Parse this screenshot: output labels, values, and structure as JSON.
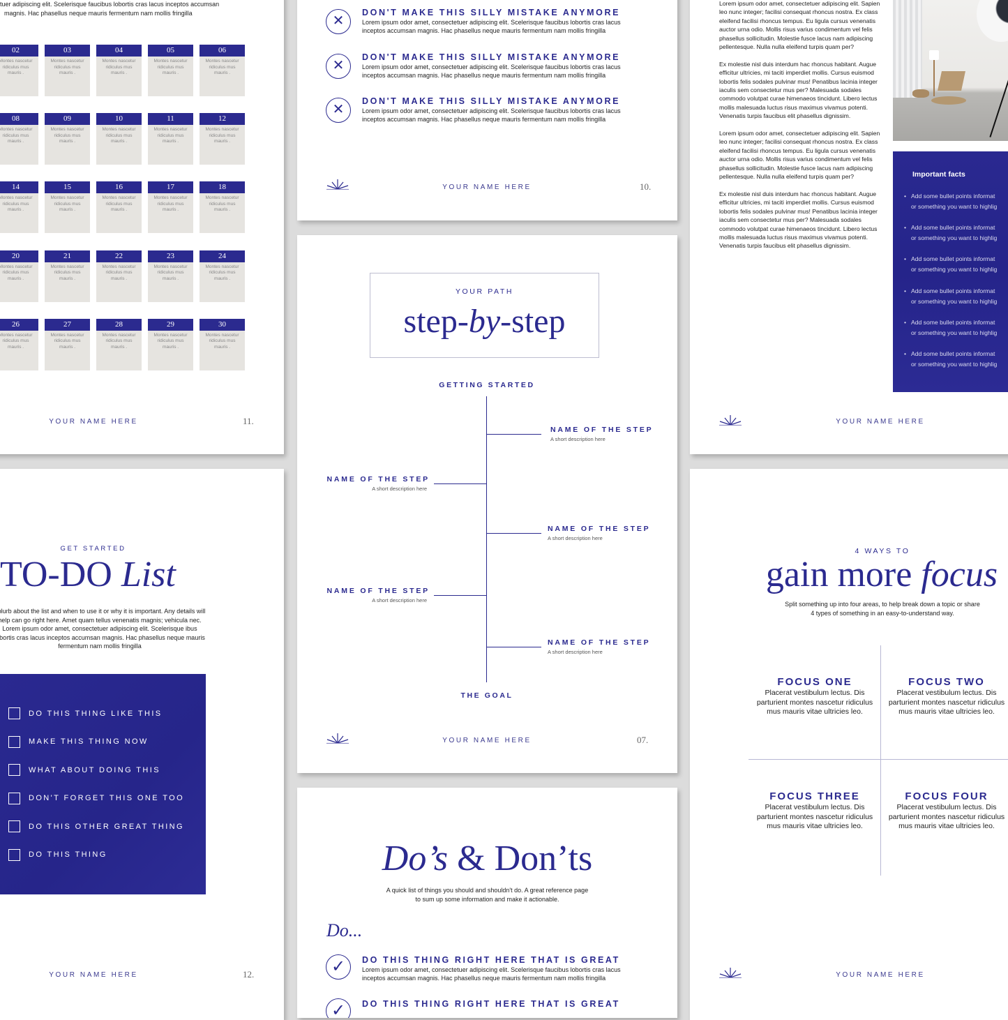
{
  "footer_name": "YOUR NAME HERE",
  "colors": {
    "accent": "#2b2a8f",
    "tile_bg": "#e6e4e0",
    "canvas": "#dcdcdc"
  },
  "calendar_page": {
    "intro_line1": "tuer adipiscing elit. Scelerisque faucibus lobortis cras lacus inceptos accumsan",
    "intro_line2": "magnis. Hac phasellus neque mauris fermentum nam mollis fringilla",
    "tile_text": "Montes nascetur ridiculus mus mauris .",
    "rows": [
      [
        "02",
        "03",
        "04",
        "05",
        "06"
      ],
      [
        "08",
        "09",
        "10",
        "11",
        "12"
      ],
      [
        "14",
        "15",
        "16",
        "17",
        "18"
      ],
      [
        "20",
        "21",
        "22",
        "23",
        "24"
      ],
      [
        "26",
        "27",
        "28",
        "29",
        "30"
      ]
    ],
    "page_number": "11."
  },
  "todo_page": {
    "eyebrow": "GET STARTED",
    "title_plain": "TO-DO ",
    "title_italic": "List",
    "blurb": "t blurb about the list and when to use it or why it is important. Any details will help can go right here.  Amet quam tellus venenatis magnis; vehicula nec. Lorem ipsum odor amet, consectetuer adipiscing elit. Scelerisque ibus lobortis cras lacus inceptos accumsan magnis. Hac phasellus neque mauris fermentum nam mollis fringilla",
    "items": [
      "DO THIS THING LIKE THIS",
      "MAKE THIS THING NOW",
      "WHAT ABOUT DOING THIS",
      "DON'T FORGET THIS ONE TOO",
      "DO THIS OTHER GREAT THING",
      "DO THIS THING"
    ],
    "page_number": "12."
  },
  "donts_page": {
    "items": [
      {
        "title": "DON'T MAKE THIS SILLY MISTAKE ANYMORE",
        "text": "Lorem ipsum odor amet, consectetuer adipiscing elit. Scelerisque faucibus lobortis cras lacus inceptos accumsan magnis. Hac phasellus neque mauris fermentum nam mollis fringilla",
        "icon": "x-mark-icon"
      },
      {
        "title": "DON'T MAKE THIS SILLY MISTAKE ANYMORE",
        "text": "Lorem ipsum odor amet, consectetuer adipiscing elit. Scelerisque faucibus lobortis cras lacus inceptos accumsan magnis. Hac phasellus neque mauris fermentum nam mollis fringilla",
        "icon": "x-mark-icon"
      },
      {
        "title": "DON'T MAKE THIS SILLY MISTAKE ANYMORE",
        "text": "Lorem ipsum odor amet, consectetuer adipiscing elit. Scelerisque faucibus lobortis cras lacus inceptos accumsan magnis. Hac phasellus neque mauris fermentum nam mollis fringilla",
        "icon": "x-mark-icon"
      }
    ],
    "page_number": "10."
  },
  "steps_page": {
    "eyebrow": "YOUR PATH",
    "title_a": "step-",
    "title_b": "by",
    "title_c": "-step",
    "start": "GETTING STARTED",
    "goal": "THE GOAL",
    "steps": [
      {
        "title": "NAME OF THE STEP",
        "desc": "A short description here",
        "side": "right"
      },
      {
        "title": "NAME OF THE STEP",
        "desc": "A short description here",
        "side": "left"
      },
      {
        "title": "NAME OF THE STEP",
        "desc": "A short description here",
        "side": "right"
      },
      {
        "title": "NAME OF THE STEP",
        "desc": "A short description here",
        "side": "left"
      },
      {
        "title": "NAME OF THE STEP",
        "desc": "A short description here",
        "side": "right"
      }
    ],
    "page_number": "07."
  },
  "dos_page": {
    "title_italic": "Do’s",
    "title_rest": " & Don’ts",
    "subtitle_line1": "A quick list of things you should and shouldn't do. A great reference page",
    "subtitle_line2": "to sum up some information and make it actionable.",
    "do_heading": "Do...",
    "items": [
      {
        "title": "DO THIS THING RIGHT HERE THAT IS GREAT",
        "text": "Lorem ipsum odor amet, consectetuer adipiscing elit. Scelerisque faucibus lobortis cras lacus inceptos accumsan magnis. Hac phasellus neque mauris fermentum nam mollis fringilla",
        "icon": "checkmark-icon"
      },
      {
        "title": "DO THIS THING RIGHT HERE THAT IS GREAT",
        "icon": "checkmark-icon"
      }
    ]
  },
  "article_page": {
    "paragraphs": [
      "Lorem ipsum odor amet, consectetuer adipiscing elit. Sapien leo nunc integer; facilisi consequat rhoncus nostra. Ex class eleifend facilisi rhoncus tempus. Eu ligula cursus venenatis auctor urna odio. Mollis risus varius condimentum vel felis phasellus sollicitudin. Molestie fusce lacus nam adipiscing pellentesque. Nulla nulla eleifend turpis quam per?",
      "Ex molestie nisl duis interdum hac rhoncus habitant. Augue efficitur ultricies, mi taciti imperdiet mollis. Cursus euismod lobortis felis sodales pulvinar mus! Penatibus lacinia integer iaculis sem consectetur mus per? Malesuada sodales commodo volutpat curae himenaeos tincidunt. Libero lectus mollis malesuada luctus risus maximus vivamus potenti. Venenatis turpis faucibus elit phasellus dignissim.",
      "Lorem ipsum odor amet, consectetuer adipiscing elit. Sapien leo nunc integer; facilisi consequat rhoncus nostra. Ex class eleifend facilisi rhoncus tempus. Eu ligula cursus venenatis auctor urna odio. Mollis risus varius condimentum vel felis phasellus sollicitudin. Molestie fusce lacus nam adipiscing pellentesque. Nulla nulla eleifend turpis quam per?",
      "Ex molestie nisl duis interdum hac rhoncus habitant. Augue efficitur ultricies, mi taciti imperdiet mollis. Cursus euismod lobortis felis sodales pulvinar mus! Penatibus lacinia integer iaculis sem consectetur mus per? Malesuada sodales commodo volutpat curae himenaeos tincidunt. Libero lectus mollis malesuada luctus risus maximus vivamus potenti. Venenatis turpis faucibus elit phasellus dignissim."
    ],
    "facts_title": "Important facts",
    "facts": [
      [
        "Add some bullet points informat",
        "or something you want to highlig"
      ],
      [
        "Add some bullet points informat",
        "or something you want to highlig"
      ],
      [
        "Add some bullet points informat",
        "or something you want to highlig"
      ],
      [
        "Add some bullet points informat",
        "or something you want to highlig"
      ],
      [
        "Add some bullet points informat",
        "or something you want to highlig"
      ],
      [
        "Add some bullet points informat",
        "or something you want to highlig"
      ]
    ]
  },
  "focus_page": {
    "eyebrow": "4 WAYS TO",
    "title_plain": "gain more ",
    "title_italic": "focus",
    "subtitle_line1": "Split something up into four areas, to help break down a topic or share",
    "subtitle_line2": "4 types of something in an easy-to-understand way.",
    "quadrants": [
      {
        "title": "FOCUS ONE",
        "text": "Placerat vestibulum lectus. Dis parturient montes nascetur ridiculus mus mauris vitae ultricies leo."
      },
      {
        "title": "FOCUS TWO",
        "text": "Placerat vestibulum lectus. Dis parturient montes nascetur ridiculus mus mauris vitae ultricies leo."
      },
      {
        "title": "FOCUS THREE",
        "text": "Placerat vestibulum lectus. Dis parturient montes nascetur ridiculus mus mauris vitae ultricies leo."
      },
      {
        "title": "FOCUS FOUR",
        "text": "Placerat vestibulum lectus. Dis parturient montes nascetur ridiculus mus mauris vitae ultricies leo."
      }
    ]
  }
}
